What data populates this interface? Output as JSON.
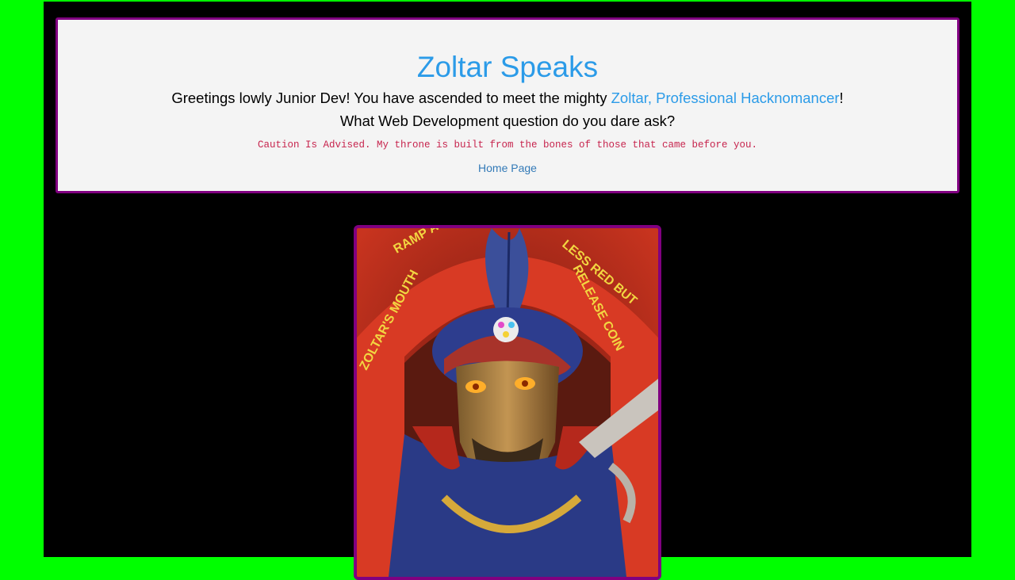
{
  "header": {
    "title": "Zoltar Speaks",
    "greeting_before": "Greetings lowly Junior Dev! You have ascended to meet the mighty ",
    "greeting_link": "Zoltar, Professional Hacknomancer",
    "greeting_after": "!",
    "question": "What Web Development question do you dare ask?",
    "caution": "Caution Is Advised. My throne is built from the bones of those that came before you.",
    "home_link": "Home Page"
  },
  "portrait": {
    "sign_left": "ZOLTAR'S MOUTH",
    "sign_top": "RAMP A",
    "sign_right": "LESS RED BUT",
    "sign_coin": "RELEASE COIN"
  },
  "colors": {
    "background": "#00ff00",
    "panel_border": "#800080",
    "accent": "#2b9be8",
    "caution": "#c7254e"
  }
}
